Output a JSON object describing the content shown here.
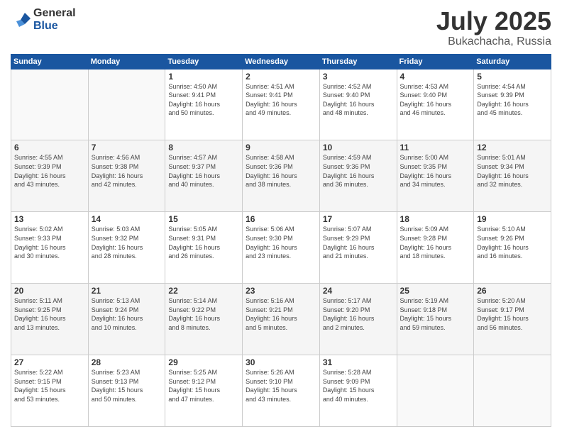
{
  "logo": {
    "general": "General",
    "blue": "Blue"
  },
  "header": {
    "month": "July 2025",
    "location": "Bukachacha, Russia"
  },
  "weekdays": [
    "Sunday",
    "Monday",
    "Tuesday",
    "Wednesday",
    "Thursday",
    "Friday",
    "Saturday"
  ],
  "weeks": [
    [
      {
        "day": "",
        "info": ""
      },
      {
        "day": "",
        "info": ""
      },
      {
        "day": "1",
        "info": "Sunrise: 4:50 AM\nSunset: 9:41 PM\nDaylight: 16 hours\nand 50 minutes."
      },
      {
        "day": "2",
        "info": "Sunrise: 4:51 AM\nSunset: 9:41 PM\nDaylight: 16 hours\nand 49 minutes."
      },
      {
        "day": "3",
        "info": "Sunrise: 4:52 AM\nSunset: 9:40 PM\nDaylight: 16 hours\nand 48 minutes."
      },
      {
        "day": "4",
        "info": "Sunrise: 4:53 AM\nSunset: 9:40 PM\nDaylight: 16 hours\nand 46 minutes."
      },
      {
        "day": "5",
        "info": "Sunrise: 4:54 AM\nSunset: 9:39 PM\nDaylight: 16 hours\nand 45 minutes."
      }
    ],
    [
      {
        "day": "6",
        "info": "Sunrise: 4:55 AM\nSunset: 9:39 PM\nDaylight: 16 hours\nand 43 minutes."
      },
      {
        "day": "7",
        "info": "Sunrise: 4:56 AM\nSunset: 9:38 PM\nDaylight: 16 hours\nand 42 minutes."
      },
      {
        "day": "8",
        "info": "Sunrise: 4:57 AM\nSunset: 9:37 PM\nDaylight: 16 hours\nand 40 minutes."
      },
      {
        "day": "9",
        "info": "Sunrise: 4:58 AM\nSunset: 9:36 PM\nDaylight: 16 hours\nand 38 minutes."
      },
      {
        "day": "10",
        "info": "Sunrise: 4:59 AM\nSunset: 9:36 PM\nDaylight: 16 hours\nand 36 minutes."
      },
      {
        "day": "11",
        "info": "Sunrise: 5:00 AM\nSunset: 9:35 PM\nDaylight: 16 hours\nand 34 minutes."
      },
      {
        "day": "12",
        "info": "Sunrise: 5:01 AM\nSunset: 9:34 PM\nDaylight: 16 hours\nand 32 minutes."
      }
    ],
    [
      {
        "day": "13",
        "info": "Sunrise: 5:02 AM\nSunset: 9:33 PM\nDaylight: 16 hours\nand 30 minutes."
      },
      {
        "day": "14",
        "info": "Sunrise: 5:03 AM\nSunset: 9:32 PM\nDaylight: 16 hours\nand 28 minutes."
      },
      {
        "day": "15",
        "info": "Sunrise: 5:05 AM\nSunset: 9:31 PM\nDaylight: 16 hours\nand 26 minutes."
      },
      {
        "day": "16",
        "info": "Sunrise: 5:06 AM\nSunset: 9:30 PM\nDaylight: 16 hours\nand 23 minutes."
      },
      {
        "day": "17",
        "info": "Sunrise: 5:07 AM\nSunset: 9:29 PM\nDaylight: 16 hours\nand 21 minutes."
      },
      {
        "day": "18",
        "info": "Sunrise: 5:09 AM\nSunset: 9:28 PM\nDaylight: 16 hours\nand 18 minutes."
      },
      {
        "day": "19",
        "info": "Sunrise: 5:10 AM\nSunset: 9:26 PM\nDaylight: 16 hours\nand 16 minutes."
      }
    ],
    [
      {
        "day": "20",
        "info": "Sunrise: 5:11 AM\nSunset: 9:25 PM\nDaylight: 16 hours\nand 13 minutes."
      },
      {
        "day": "21",
        "info": "Sunrise: 5:13 AM\nSunset: 9:24 PM\nDaylight: 16 hours\nand 10 minutes."
      },
      {
        "day": "22",
        "info": "Sunrise: 5:14 AM\nSunset: 9:22 PM\nDaylight: 16 hours\nand 8 minutes."
      },
      {
        "day": "23",
        "info": "Sunrise: 5:16 AM\nSunset: 9:21 PM\nDaylight: 16 hours\nand 5 minutes."
      },
      {
        "day": "24",
        "info": "Sunrise: 5:17 AM\nSunset: 9:20 PM\nDaylight: 16 hours\nand 2 minutes."
      },
      {
        "day": "25",
        "info": "Sunrise: 5:19 AM\nSunset: 9:18 PM\nDaylight: 15 hours\nand 59 minutes."
      },
      {
        "day": "26",
        "info": "Sunrise: 5:20 AM\nSunset: 9:17 PM\nDaylight: 15 hours\nand 56 minutes."
      }
    ],
    [
      {
        "day": "27",
        "info": "Sunrise: 5:22 AM\nSunset: 9:15 PM\nDaylight: 15 hours\nand 53 minutes."
      },
      {
        "day": "28",
        "info": "Sunrise: 5:23 AM\nSunset: 9:13 PM\nDaylight: 15 hours\nand 50 minutes."
      },
      {
        "day": "29",
        "info": "Sunrise: 5:25 AM\nSunset: 9:12 PM\nDaylight: 15 hours\nand 47 minutes."
      },
      {
        "day": "30",
        "info": "Sunrise: 5:26 AM\nSunset: 9:10 PM\nDaylight: 15 hours\nand 43 minutes."
      },
      {
        "day": "31",
        "info": "Sunrise: 5:28 AM\nSunset: 9:09 PM\nDaylight: 15 hours\nand 40 minutes."
      },
      {
        "day": "",
        "info": ""
      },
      {
        "day": "",
        "info": ""
      }
    ]
  ]
}
